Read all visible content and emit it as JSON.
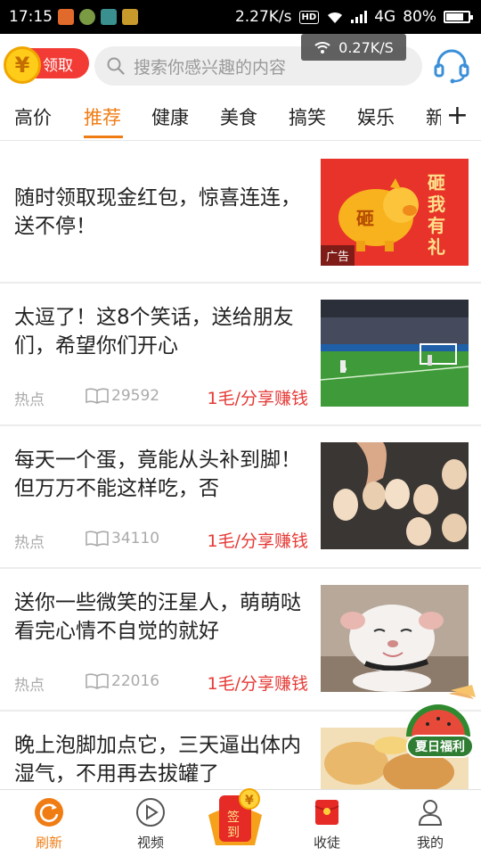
{
  "statusbar": {
    "time": "17:15",
    "net_speed": "2.27K/s",
    "hd": "HD",
    "network": "4G",
    "battery": "80%",
    "battery_level": 0.8
  },
  "header": {
    "coin_symbol": "¥",
    "claim_label": "领取",
    "search_placeholder": "搜索你感兴趣的内容",
    "speed_toast": "0.27K/S"
  },
  "tabs": [
    {
      "label": "高价"
    },
    {
      "label": "推荐",
      "active": true
    },
    {
      "label": "健康"
    },
    {
      "label": "美食"
    },
    {
      "label": "搞笑"
    },
    {
      "label": "娱乐"
    },
    {
      "label": "新"
    }
  ],
  "tabs_plus": "+",
  "feed": [
    {
      "title": "随时领取现金红包，惊喜连连，送不停！",
      "ad_badge": "广告",
      "ad_text": "砸我有礼",
      "ad_pig_char": "砸"
    },
    {
      "title": "太逗了！这8个笑话，送给朋友们，希望你们开心",
      "tag": "热点",
      "reads": "29592",
      "earn": "1毛/分享赚钱"
    },
    {
      "title": "每天一个蛋，竟能从头补到脚！但万万不能这样吃，否",
      "tag": "热点",
      "reads": "34110",
      "earn": "1毛/分享赚钱"
    },
    {
      "title": "送你一些微笑的汪星人，萌萌哒看完心情不自觉的就好",
      "tag": "热点",
      "reads": "22016",
      "earn": "1毛/分享赚钱"
    },
    {
      "title": "晚上泡脚加点它，三天逼出体内湿气，不用再去拔罐了"
    }
  ],
  "summer_badge": "夏日福利",
  "bottomnav": {
    "refresh": "刷新",
    "video": "视频",
    "signin_top": "签",
    "signin_bottom": "到",
    "signin_coin": "¥",
    "collect": "收徒",
    "mine": "我的"
  },
  "colors": {
    "accent": "#f07c14",
    "earn": "#e53935",
    "claim": "#f23b35"
  }
}
